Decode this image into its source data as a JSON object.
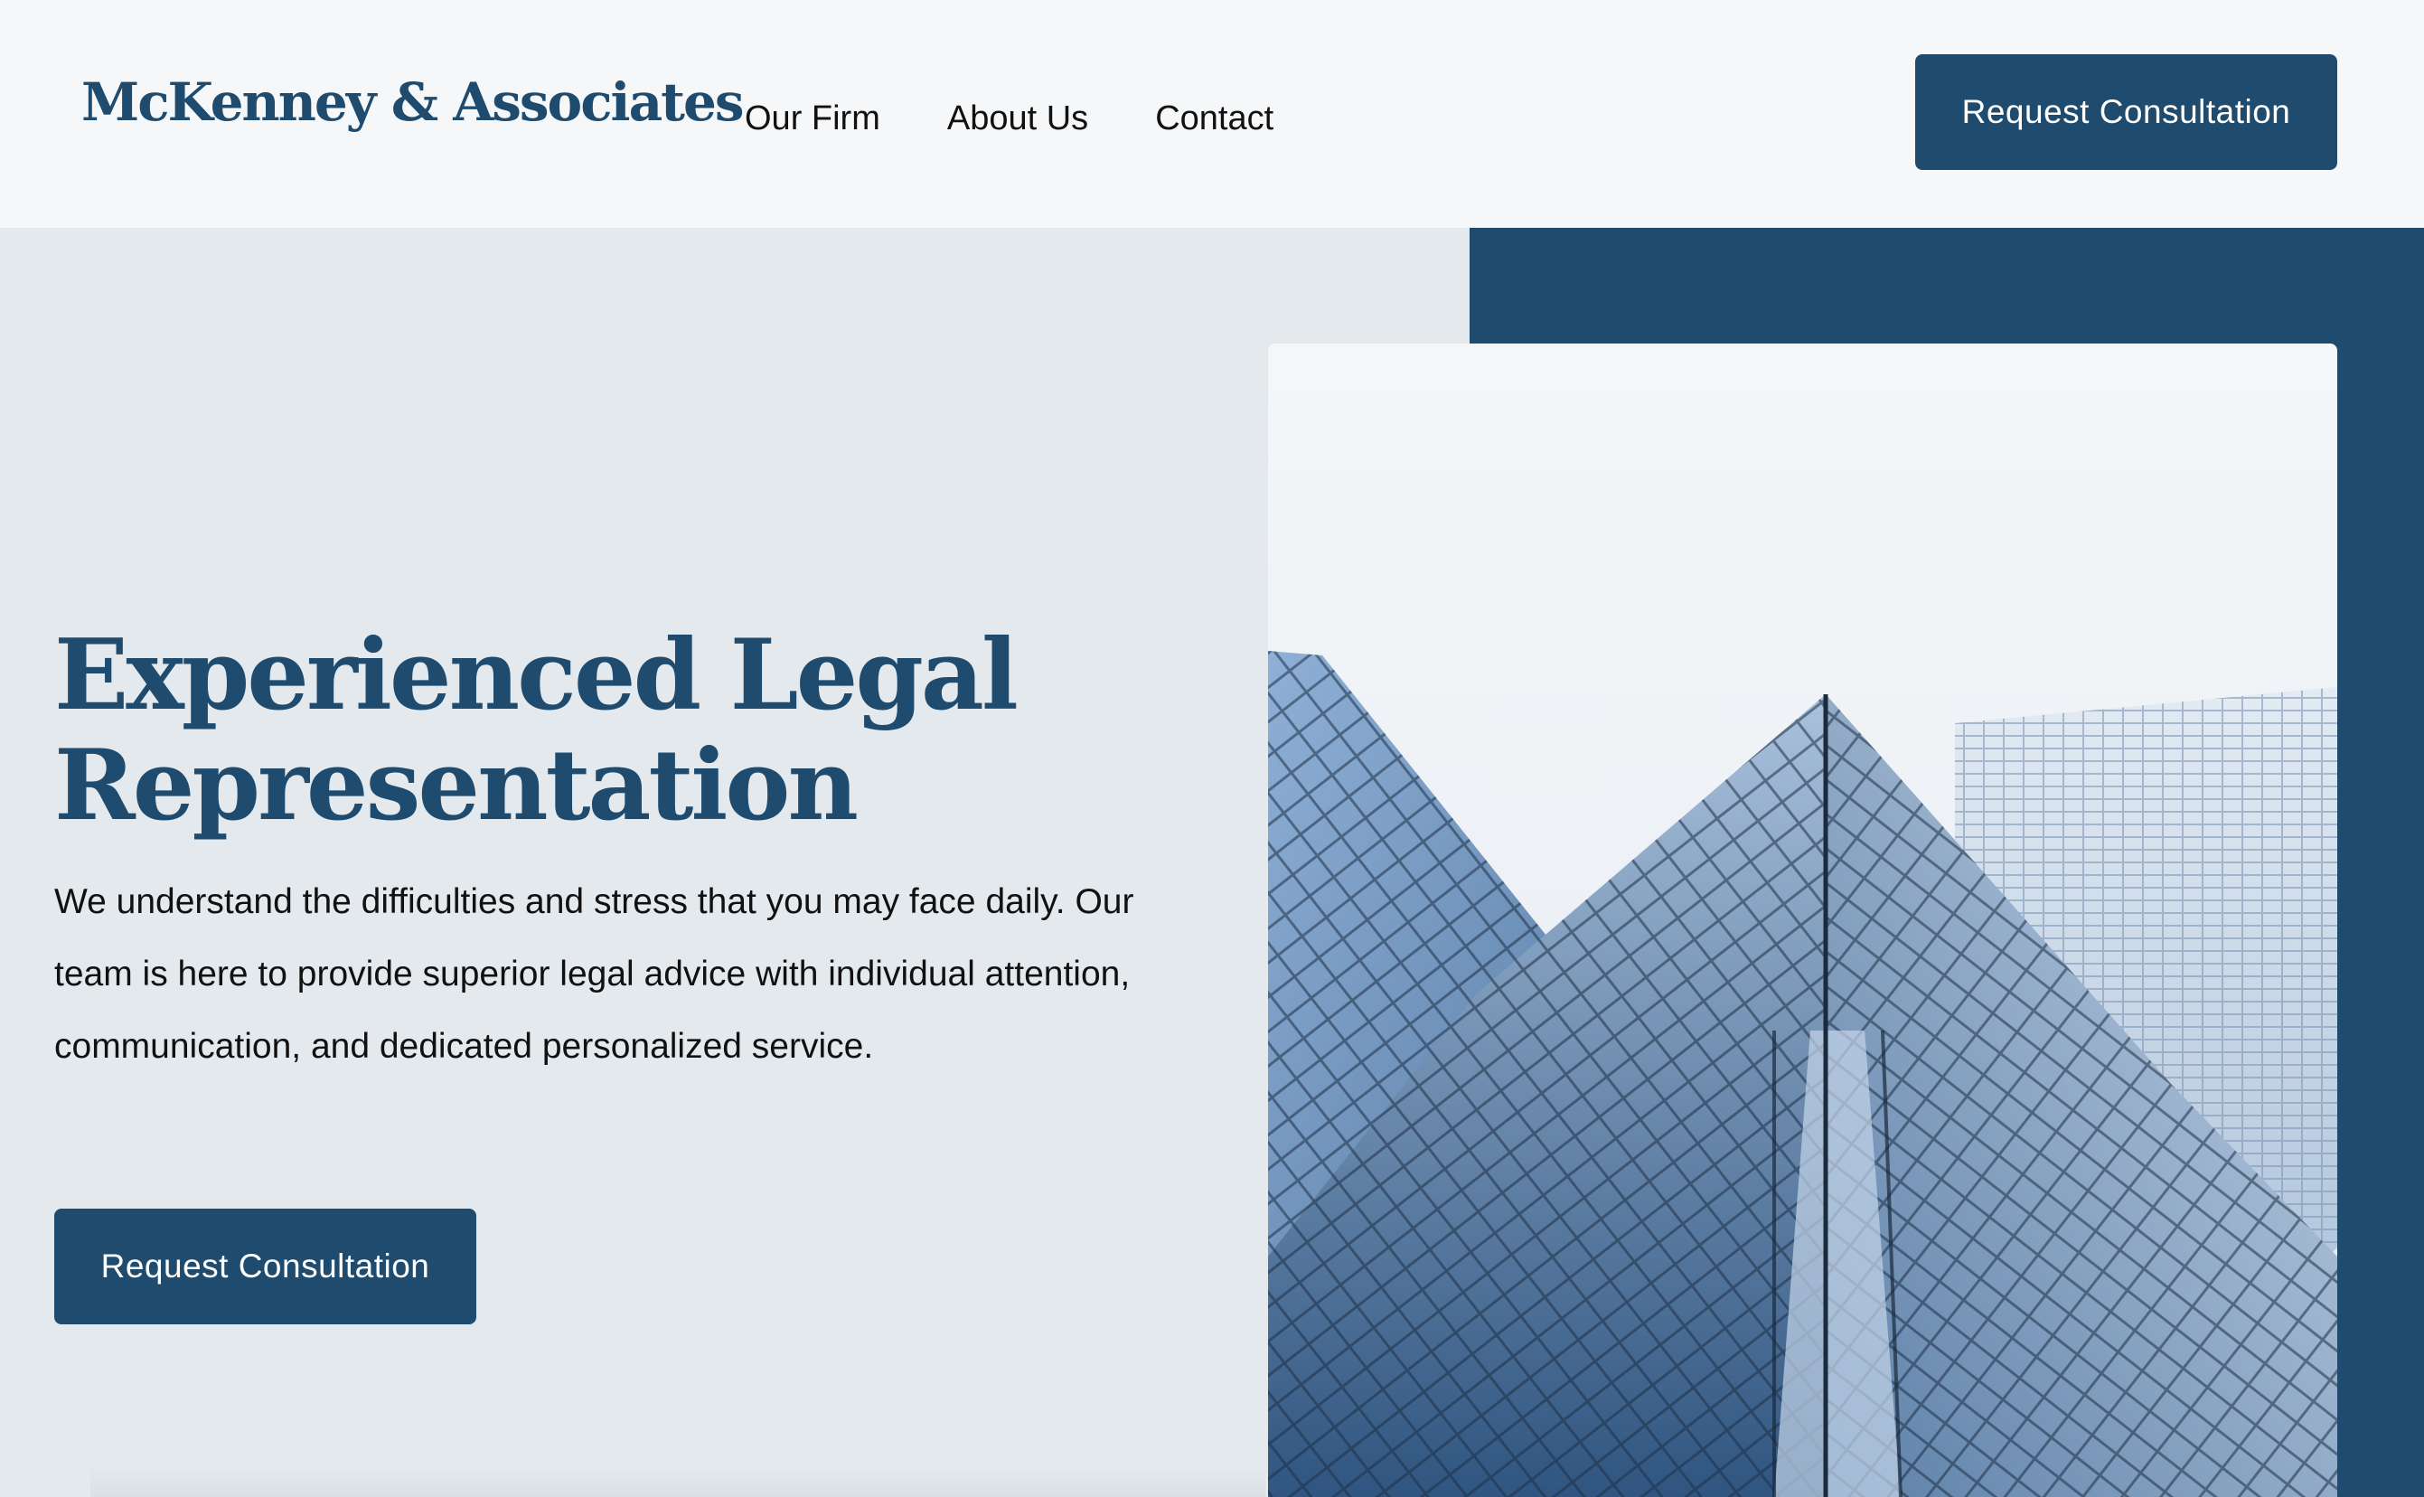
{
  "header": {
    "logo": "McKenney & Associates",
    "nav": [
      "Our Firm",
      "About Us",
      "Contact"
    ],
    "cta_label": "Request Consultation"
  },
  "hero": {
    "title_line1": "Experienced Legal",
    "title_line2": "Representation",
    "description": "We understand the difficulties and stress that you may face daily. Our team is here to provide superior legal advice with individual attention, communication, and dedicated personalized service.",
    "cta_label": "Request Consultation",
    "image": "glass-skyscraper-photo"
  },
  "colors": {
    "brand": "#1f4b6e",
    "header_bg": "#f5f7f9",
    "hero_bg": "#e4e9ed",
    "text": "#111111"
  }
}
